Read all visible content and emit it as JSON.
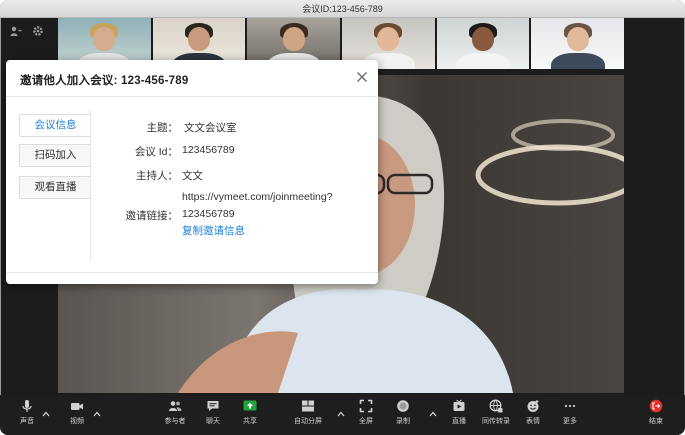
{
  "window": {
    "title": "会议ID:123-456-789"
  },
  "dialog": {
    "title": "邀请他人加入会议: 123-456-789",
    "tabs": [
      {
        "label": "会议信息",
        "active": true
      },
      {
        "label": "扫码加入",
        "active": false
      },
      {
        "label": "观看直播",
        "active": false
      }
    ],
    "info": {
      "topic_label": "主题：",
      "topic_value": "文文会议室",
      "meeting_id_label": "会议 Id：",
      "meeting_id_value": "123456789",
      "host_label": "主持人：",
      "host_value": "文文",
      "invite_link_label": "邀请链接：",
      "invite_link_line1": "https://vymeet.com/joinmeeting?",
      "invite_link_line2": "123456789",
      "copy_link_label": "复制邀请信息"
    }
  },
  "toolbar": {
    "audio_label": "声音",
    "video_label": "视频",
    "participants_label": "参与者",
    "chat_label": "聊天",
    "share_label": "共享",
    "auto_split_label": "自动分屏",
    "fullscreen_label": "全屏",
    "record_label": "录制",
    "live_label": "直播",
    "transcribe_label": "同传转录",
    "reactions_label": "表情",
    "more_label": "更多",
    "end_label": "结束"
  },
  "colors": {
    "accent": "#1a7fd8",
    "end_button": "#e0332f",
    "share_icon": "#23a33b"
  }
}
